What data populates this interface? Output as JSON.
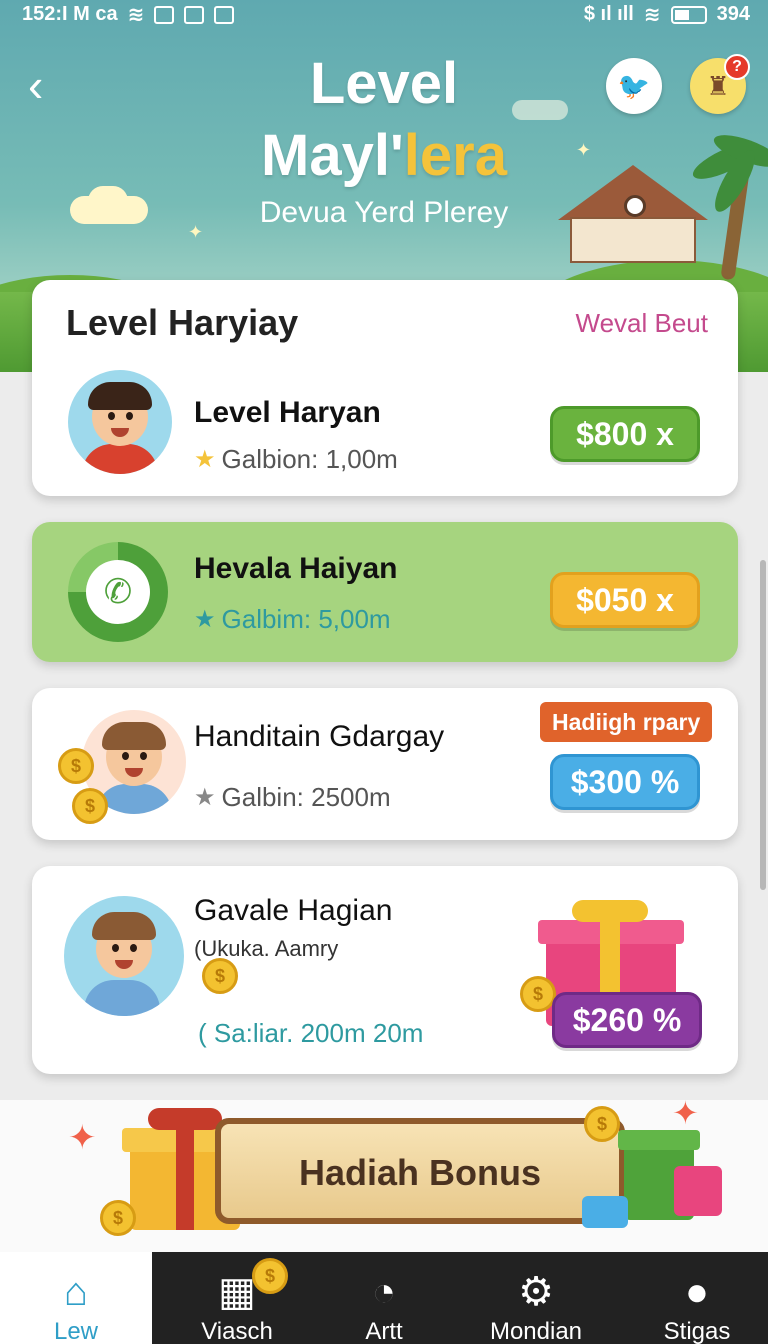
{
  "status_bar": {
    "left_text": "152:I M ca",
    "right_text": "$ ıl ıll",
    "battery": "394"
  },
  "header": {
    "title_line1": "Level",
    "title_line2_white": "Mayl'",
    "title_line2_yellow": "lera",
    "subtitle": "Devua Yerd Plerey",
    "back_icon": "chevron-left-icon",
    "notification_count": "?"
  },
  "card1": {
    "heading": "Level Haryiay",
    "link": "Weval Beut",
    "row": {
      "title": "Level Haryan",
      "meta": "Galbion: 1,00m",
      "price": "$800 x"
    }
  },
  "card2": {
    "title": "Hevala Haiyan",
    "meta": "Galbim: 5,00m",
    "price": "$050 x"
  },
  "card3": {
    "title": "Handitain Gdargay",
    "tag": "Hadiigh rpary",
    "meta": "Galbin: 2500m",
    "price": "$300 %"
  },
  "card4": {
    "title": "Gavale Hagian",
    "subtitle": "(Ukuka. Aamry",
    "meta": "( Sa:liar. 200m 20m",
    "price": "$260 %"
  },
  "bonus": {
    "label": "Hadiah Bonus"
  },
  "nav": [
    {
      "label": "Lew",
      "icon": "home-icon"
    },
    {
      "label": "Viasch",
      "icon": "shop-icon"
    },
    {
      "label": "Artt",
      "icon": "compass-icon"
    },
    {
      "label": "Mondian",
      "icon": "gear-icon"
    },
    {
      "label": "Stigas",
      "icon": "user-icon"
    }
  ],
  "colors": {
    "header_teal": "#5fa9b0",
    "accent_yellow": "#f4c33a",
    "green_card": "#a6d47f",
    "link_pink": "#c44a8d",
    "nav_active": "#2f9ec7"
  }
}
